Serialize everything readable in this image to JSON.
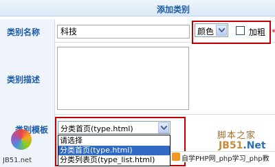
{
  "header": {
    "title": "添加类别"
  },
  "form": {
    "name": {
      "label": "类别名称",
      "value": "科技"
    },
    "color": {
      "selected": "颜色"
    },
    "bold": {
      "label": "加粗",
      "checked": false
    },
    "required_mark": "*",
    "description": {
      "label": "类别描述",
      "value": ""
    },
    "template": {
      "label": "类别模板",
      "selected": "分类首页(type.html)",
      "options": [
        "请选择",
        "分类首页(type.html)",
        "分类列表页(type_list.html)"
      ],
      "highlighted_index": 1
    }
  },
  "watermark": {
    "site_cn": "脚本之家",
    "site_en": "JB51",
    "site_tld": ".Net",
    "php_strip": "自学PHP网_php学习_php教",
    "logo_caption": "JB51.net"
  },
  "colors": {
    "label_blue": "#1b5ba8",
    "label_bg": "#eef4fa",
    "highlight_red": "#c00000",
    "selection_blue": "#316ac5"
  }
}
